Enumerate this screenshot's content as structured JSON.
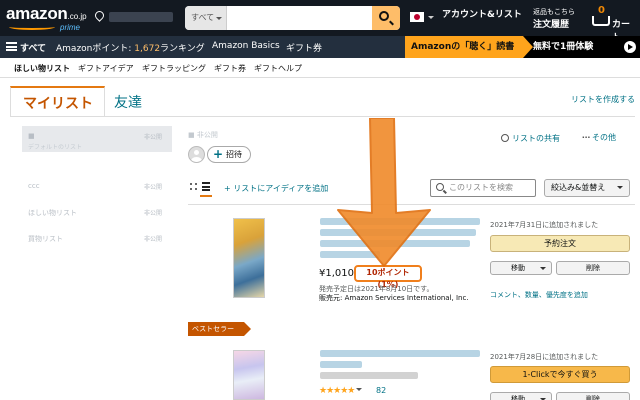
{
  "header": {
    "logo": "amazon",
    "logo_suffix": ".co.jp",
    "logo_tag": "prime",
    "search_category": "すべて",
    "account_line1": "",
    "account_line2": "アカウント&リスト",
    "returns_line1": "返品もこちら",
    "returns_line2": "注文履歴",
    "cart_count": "0",
    "cart_label": "カート"
  },
  "subnav": {
    "all_label": "すべて",
    "points_label": "Amazonポイント:",
    "points_value": "1,672",
    "ranking": "ランキング",
    "basics": "Amazon Basics",
    "gift_card": "ギフト券",
    "banner_left": "Amazonの「聴く」読書",
    "banner_right": "無料で1冊体験"
  },
  "listnav": {
    "items": [
      "ほしい物リスト",
      "ギフトアイデア",
      "ギフトラッピング",
      "ギフト券",
      "ギフトヘルプ"
    ]
  },
  "tabs": {
    "my_list": "マイリスト",
    "friends": "友達",
    "create_list": "リストを作成する"
  },
  "sidebar": {
    "items": [
      {
        "name": "■",
        "sub": "デフォルトのリスト",
        "privacy": "非公開"
      },
      {
        "name": "",
        "sub": "",
        "privacy": ""
      },
      {
        "name": "ccc",
        "sub": "",
        "privacy": "非公開"
      },
      {
        "name": "ほしい物リスト",
        "sub": "",
        "privacy": "非公開"
      },
      {
        "name": "買物リスト",
        "sub": "",
        "privacy": "非公開"
      }
    ]
  },
  "main": {
    "owner": "■ 非公開",
    "invite": "招待",
    "share": "リストの共有",
    "more": "その他",
    "add_idea": "+ リストにアイディアを追加",
    "search_placeholder": "このリストを検索",
    "filter": "絞込み&並替え"
  },
  "items": [
    {
      "price": "¥1,010",
      "points": "10ポイント(1%)",
      "release": "発売予定日は2021年8月10日です。",
      "seller_prefix": "販売元:",
      "seller": "Amazon Services International, Inc.",
      "added": "2021年7月31日に追加されました",
      "primary_action": "予約注文",
      "move": "移動",
      "delete": "削除",
      "comment_link": "コメント、数量、優先度を追加"
    },
    {
      "badge": "ベストセラー",
      "stars": "★★★★★",
      "rating_count": "82",
      "added": "2021年7月28日に追加されました",
      "primary_action": "1-Clickで今すぐ買う",
      "move": "移動",
      "delete": "削除"
    }
  ],
  "colors": {
    "nav_dark": "#131921",
    "subnav": "#232f3e",
    "accent_orange": "#f07f1c",
    "link_teal": "#007185",
    "price_red": "#b12704"
  }
}
